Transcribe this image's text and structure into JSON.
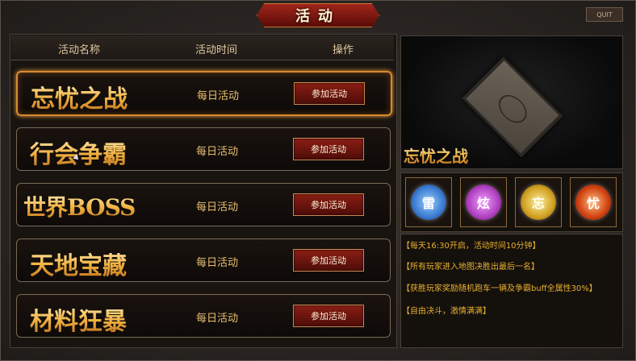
{
  "window": {
    "title": "活动",
    "quit_label": "QUIT"
  },
  "table": {
    "headers": [
      "活动名称",
      "活动时间",
      "操作"
    ],
    "rows": [
      {
        "name": "忘忧之战",
        "time": "每日活动",
        "action": "参加活动",
        "active": true
      },
      {
        "name": "行会争霸",
        "time": "每日活动",
        "action": "参加活动",
        "active": false
      },
      {
        "name": "世界BOSS",
        "time": "每日活动",
        "action": "参加活动",
        "active": false
      },
      {
        "name": "天地宝藏",
        "time": "每日活动",
        "action": "参加活动",
        "active": false
      },
      {
        "name": "材料狂暴",
        "time": "每日活动",
        "action": "参加活动",
        "active": false
      }
    ]
  },
  "preview": {
    "title": "忘忧之战"
  },
  "rewards": [
    {
      "glyph": "雷",
      "color": "#3a7ad0"
    },
    {
      "glyph": "炫",
      "color": "#b040c0"
    },
    {
      "glyph": "忘",
      "color": "#d0a020"
    },
    {
      "glyph": "忧",
      "color": "#d04010"
    }
  ],
  "info": [
    "【每天16:30开启，活动时间10分钟】",
    "【所有玩家进入地图决胜出最后一名】",
    "【获胜玩家奖励随机跑车一辆及争霸buff全属性30%】",
    "【自由决斗，激情满满】"
  ]
}
